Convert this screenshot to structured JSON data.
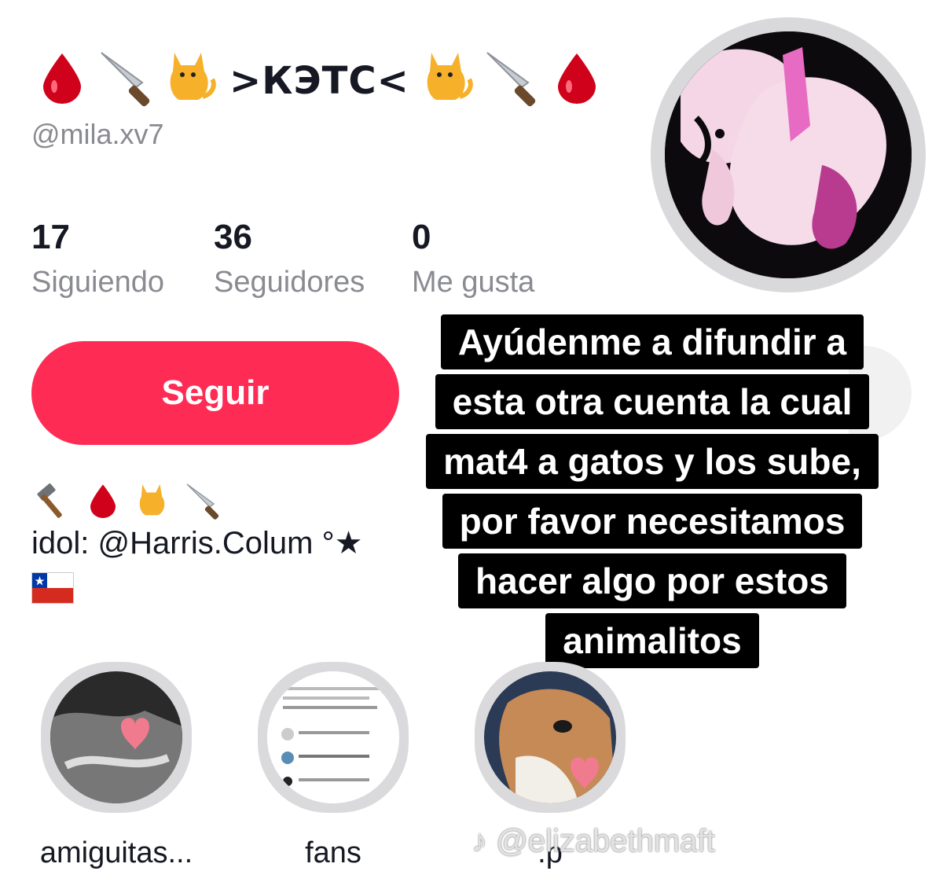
{
  "profile": {
    "display_name": ">КЭТС<",
    "username": "@mila.xv7",
    "title_icons_left": [
      "blood-drop-icon",
      "knife-icon",
      "cat-icon"
    ],
    "title_icons_right": [
      "cat-icon",
      "knife-icon",
      "blood-drop-icon"
    ]
  },
  "stats": [
    {
      "value": "17",
      "label": "Siguiendo"
    },
    {
      "value": "36",
      "label": "Seguidores"
    },
    {
      "value": "0",
      "label": "Me gusta"
    }
  ],
  "actions": {
    "follow_label": "Seguir"
  },
  "bio": {
    "emoji_icons": [
      "hammer-icon",
      "blood-drop-icon",
      "cat-icon",
      "knife-icon"
    ],
    "line": "idol: @Harris.Colum °★",
    "flag": "chile-flag-icon"
  },
  "caption": {
    "lines": [
      "Ayúdenme a difundir a",
      "esta otra cuenta la cual",
      "mat4 a gatos y los sube,",
      "por favor necesitamos",
      "hacer algo por estos",
      "animalitos"
    ]
  },
  "highlights": [
    {
      "label": "amiguitas..."
    },
    {
      "label": "fans"
    },
    {
      "label": ".p"
    }
  ],
  "watermark": "♪ @elizabethmaft",
  "colors": {
    "accent": "#fe2c55",
    "muted": "#8a8b91",
    "text": "#161823"
  }
}
